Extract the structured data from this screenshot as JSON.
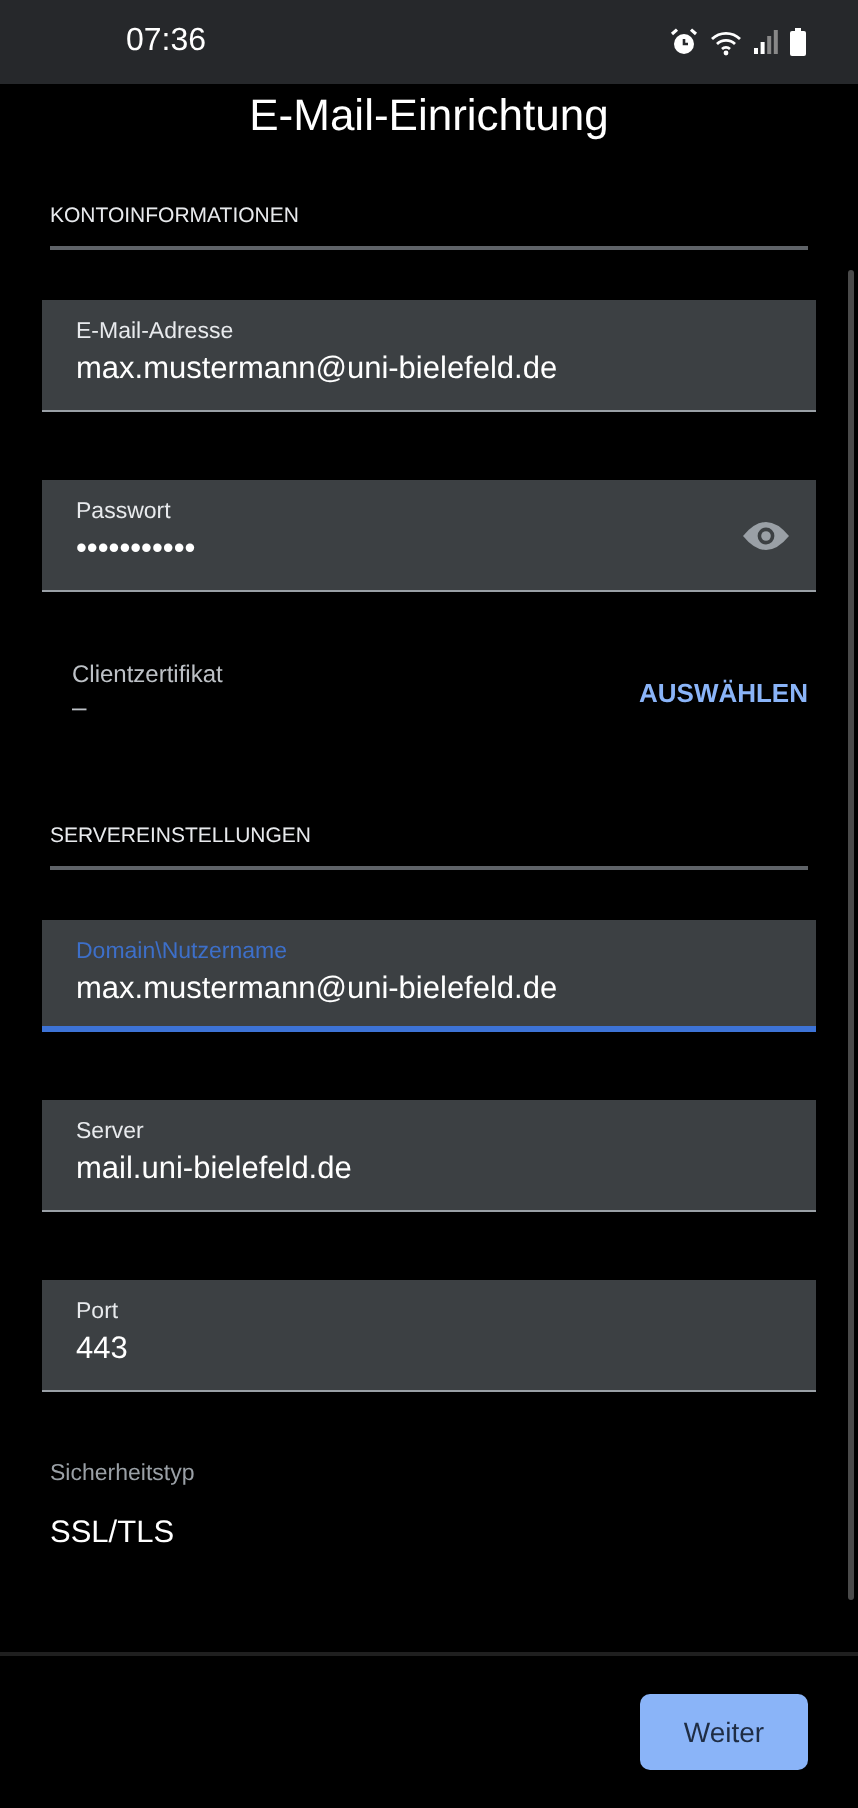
{
  "status_bar": {
    "time": "07:36"
  },
  "title": "E-Mail-Einrichtung",
  "sections": [
    {
      "heading": "KONTOINFORMATIONEN",
      "items": [
        {
          "kind": "text_field",
          "label": "E-Mail-Adresse",
          "value": "max.mustermann@uni-bielefeld.de",
          "focused": false
        },
        {
          "kind": "password_field",
          "label": "Passwort",
          "value": "•••••••••••",
          "focused": false
        },
        {
          "kind": "certificate",
          "label": "Clientzertifikat",
          "value": "–",
          "action": "AUSWÄHLEN"
        }
      ]
    },
    {
      "heading": "SERVEREINSTELLUNGEN",
      "items": [
        {
          "kind": "text_field",
          "label": "Domain\\Nutzername",
          "value": "max.mustermann@uni-bielefeld.de",
          "focused": true
        },
        {
          "kind": "text_field",
          "label": "Server",
          "value": "mail.uni-bielefeld.de",
          "focused": false
        },
        {
          "kind": "text_field",
          "label": "Port",
          "value": "443",
          "focused": false
        },
        {
          "kind": "select",
          "label": "Sicherheitstyp",
          "value": "SSL/TLS"
        }
      ]
    }
  ],
  "next_button": "Weiter"
}
